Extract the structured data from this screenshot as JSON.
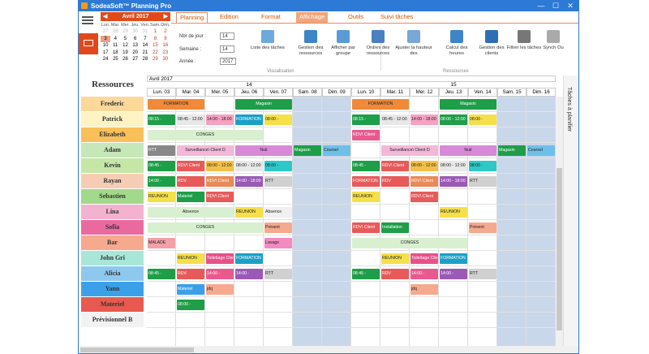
{
  "window": {
    "title": "SodeaSoft™ Planning Pro",
    "minimize": "—",
    "maximize": "☐",
    "close": "✕"
  },
  "calendar": {
    "month": "Avril 2017",
    "prev": "◀",
    "next": "▶",
    "weekdays": [
      "Lun.",
      "Mar.",
      "Mer.",
      "Jeu.",
      "Ven.",
      "Sam.",
      "Dim."
    ],
    "days": [
      [
        "27",
        "28",
        "29",
        "30",
        "31",
        "1",
        "2"
      ],
      [
        "3",
        "4",
        "5",
        "6",
        "7",
        "8",
        "9"
      ],
      [
        "10",
        "11",
        "12",
        "13",
        "14",
        "15",
        "16"
      ],
      [
        "17",
        "18",
        "19",
        "20",
        "21",
        "22",
        "23"
      ],
      [
        "24",
        "25",
        "26",
        "27",
        "28",
        "29",
        "30"
      ]
    ]
  },
  "tabs": [
    "Planning",
    "Edition",
    "Format",
    "Affichage",
    "Outils",
    "Suivi tâches"
  ],
  "visualisation": {
    "nbr_jour_label": "Nbr de jour :",
    "nbr_jour": "14",
    "semaine_label": "Semaine :",
    "semaine": "14",
    "annee_label": "Année :",
    "annee": "2017",
    "group_label": "Visualisation"
  },
  "ribbon_buttons": [
    {
      "label": "Liste des tâches",
      "color": "#6fa8dc"
    },
    {
      "label": "Gestion des ressources",
      "color": "#3d85c6"
    },
    {
      "label": "Afficher par groupe",
      "color": "#5b9bd5"
    },
    {
      "label": "Ordres des ressources",
      "color": "#4a7fc1"
    },
    {
      "label": "Ajuster la hauteur des",
      "color": "#7aa6d8"
    },
    {
      "label": "Calcul des heures",
      "color": "#3d85c6"
    },
    {
      "label": "Gestion des clients",
      "color": "#2e6fb4"
    },
    {
      "label": "Filtrer les tâches",
      "color": "#777777"
    },
    {
      "label": "Synch Ou",
      "color": "#aaaaaa"
    }
  ],
  "ressources_group_label": "Ressources",
  "planning": {
    "month_label": "Avril 2017",
    "week1": "14",
    "week2": "15",
    "days": [
      "Lun. 03",
      "Mar. 04",
      "Mer. 05",
      "Jeu. 06",
      "Ven. 07",
      "Sam. 08",
      "Dim. 09",
      "Lun. 10",
      "Mar. 11",
      "Mer. 12",
      "Jeu. 13",
      "Ven. 14",
      "Sam. 15",
      "Dim. 16"
    ],
    "resources_title": "Ressources",
    "resources": [
      {
        "name": "Frederic",
        "color": "#fcd89a"
      },
      {
        "name": "Patrick",
        "color": "#fff3c4"
      },
      {
        "name": "Elizabeth",
        "color": "#f9c05a"
      },
      {
        "name": "Adam",
        "color": "#c6e7b8"
      },
      {
        "name": "Kevin",
        "color": "#c5e6a6"
      },
      {
        "name": "Rayan",
        "color": "#f6cdb4"
      },
      {
        "name": "Sebastien",
        "color": "#a2d98a"
      },
      {
        "name": "Lina",
        "color": "#f3b2cf"
      },
      {
        "name": "Sofia",
        "color": "#ea6aa0"
      },
      {
        "name": "Bar",
        "color": "#f5a98e"
      },
      {
        "name": "John Gri",
        "color": "#a8e6d8"
      },
      {
        "name": "Alicia",
        "color": "#8fc8ef"
      },
      {
        "name": "Yann",
        "color": "#3ba0e8"
      },
      {
        "name": "Materiel",
        "color": "#e85a4f"
      },
      {
        "name": "Prévisionnel B",
        "color": "#f2f2f2"
      }
    ],
    "tasks_panel": "Tâches à planifier",
    "events": [
      {
        "row": 0,
        "col": 0,
        "span": 2,
        "text": "FORMATION",
        "color": "#f08a3a"
      },
      {
        "row": 0,
        "col": 3,
        "span": 2,
        "text": "Magasin",
        "color": "#1e9e48"
      },
      {
        "row": 0,
        "col": 7,
        "span": 2,
        "text": "FORMATION",
        "color": "#f08a3a"
      },
      {
        "row": 0,
        "col": 10,
        "span": 2,
        "text": "Magasin",
        "color": "#1e9e48"
      },
      {
        "row": 1,
        "col": 0,
        "span": 1,
        "text": "08:15 -",
        "color": "#1e9e48"
      },
      {
        "row": 1,
        "col": 1,
        "span": 1,
        "text": "08:45 - 12:00",
        "color": "#e8e8e8"
      },
      {
        "row": 1,
        "col": 2,
        "span": 1,
        "text": "14:00 - 18:00",
        "color": "#f6a2c2"
      },
      {
        "row": 1,
        "col": 3,
        "span": 1,
        "text": "FORMATION",
        "color": "#1aa0c8"
      },
      {
        "row": 1,
        "col": 4,
        "span": 1,
        "text": "08:00 -",
        "color": "#f5e04a"
      },
      {
        "row": 1,
        "col": 7,
        "span": 1,
        "text": "08:15 -",
        "color": "#1e9e48"
      },
      {
        "row": 1,
        "col": 8,
        "span": 1,
        "text": "08:45 - 12:00",
        "color": "#e8e8e8"
      },
      {
        "row": 1,
        "col": 9,
        "span": 1,
        "text": "14:00 - 18:00",
        "color": "#f6a2c2"
      },
      {
        "row": 1,
        "col": 10,
        "span": 1,
        "text": "08:00 - 12:00",
        "color": "#1e9e48"
      },
      {
        "row": 1,
        "col": 11,
        "span": 1,
        "text": "08:00 -",
        "color": "#f5e04a"
      },
      {
        "row": 2,
        "col": 0,
        "span": 4,
        "text": "CONGES",
        "color": "#d8f0d0"
      },
      {
        "row": 2,
        "col": 7,
        "span": 1,
        "text": "RDV\\ Client",
        "color": "#e85a8e"
      },
      {
        "row": 3,
        "col": 0,
        "span": 1,
        "text": "RTT",
        "color": "#888888"
      },
      {
        "row": 3,
        "col": 1,
        "span": 2,
        "text": "Surveillance\\ Client D",
        "color": "#f3b8d8"
      },
      {
        "row": 3,
        "col": 3,
        "span": 2,
        "text": "Nuit",
        "color": "#d88ad8"
      },
      {
        "row": 3,
        "col": 5,
        "span": 1,
        "text": "Magasin",
        "color": "#1e9e48"
      },
      {
        "row": 3,
        "col": 6,
        "span": 1,
        "text": "Coursel",
        "color": "#6fc0e8"
      },
      {
        "row": 3,
        "col": 8,
        "span": 2,
        "text": "Surveillance\\ Client D",
        "color": "#f3b8d8"
      },
      {
        "row": 3,
        "col": 10,
        "span": 2,
        "text": "Nuit",
        "color": "#d88ad8"
      },
      {
        "row": 3,
        "col": 12,
        "span": 1,
        "text": "Magasin",
        "color": "#1e9e48"
      },
      {
        "row": 3,
        "col": 13,
        "span": 1,
        "text": "Coursel",
        "color": "#6fc0e8"
      },
      {
        "row": 4,
        "col": 0,
        "span": 1,
        "text": "08:45 -",
        "color": "#1e9e48"
      },
      {
        "row": 4,
        "col": 1,
        "span": 1,
        "text": "RDV\\ Client",
        "color": "#e85a5a"
      },
      {
        "row": 4,
        "col": 2,
        "span": 1,
        "text": "08:00 - 12:00",
        "color": "#f5c04a"
      },
      {
        "row": 4,
        "col": 3,
        "span": 1,
        "text": "08:00 - 12:00",
        "color": "#e8e8e8"
      },
      {
        "row": 4,
        "col": 4,
        "span": 1,
        "text": "08:00 -",
        "color": "#2ec8c8"
      },
      {
        "row": 4,
        "col": 7,
        "span": 1,
        "text": "08:45 -",
        "color": "#1e9e48"
      },
      {
        "row": 4,
        "col": 8,
        "span": 1,
        "text": "RDV\\ Client",
        "color": "#e85a5a"
      },
      {
        "row": 4,
        "col": 9,
        "span": 1,
        "text": "08:00 - 12:00",
        "color": "#f5c04a"
      },
      {
        "row": 4,
        "col": 10,
        "span": 1,
        "text": "08:00 - 12:00",
        "color": "#e8e8e8"
      },
      {
        "row": 4,
        "col": 11,
        "span": 1,
        "text": "08:00 -",
        "color": "#2ec8c8"
      },
      {
        "row": 5,
        "col": 0,
        "span": 1,
        "text": "14:00 -",
        "color": "#1e9e48"
      },
      {
        "row": 5,
        "col": 1,
        "span": 1,
        "text": "RDV",
        "color": "#e85a5a"
      },
      {
        "row": 5,
        "col": 2,
        "span": 1,
        "text": "RDV\\ Client",
        "color": "#e88a5a"
      },
      {
        "row": 5,
        "col": 3,
        "span": 1,
        "text": "14:00 - 18:00",
        "color": "#9b59b6"
      },
      {
        "row": 5,
        "col": 4,
        "span": 1,
        "text": "RTT",
        "color": "#d0d0d0"
      },
      {
        "row": 5,
        "col": 7,
        "span": 1,
        "text": "FORMATION",
        "color": "#e85a5a"
      },
      {
        "row": 5,
        "col": 8,
        "span": 1,
        "text": "RDV",
        "color": "#e85a5a"
      },
      {
        "row": 5,
        "col": 9,
        "span": 1,
        "text": "RDV\\ Client",
        "color": "#e88a5a"
      },
      {
        "row": 5,
        "col": 10,
        "span": 1,
        "text": "14:00 - 18:00",
        "color": "#9b59b6"
      },
      {
        "row": 5,
        "col": 11,
        "span": 1,
        "text": "RTT",
        "color": "#d0d0d0"
      },
      {
        "row": 6,
        "col": 0,
        "span": 1,
        "text": "REUNION",
        "color": "#f5e04a"
      },
      {
        "row": 6,
        "col": 1,
        "span": 1,
        "text": "Materiel",
        "color": "#1e9e48"
      },
      {
        "row": 6,
        "col": 2,
        "span": 1,
        "text": "RDV\\ Client",
        "color": "#e85a5a"
      },
      {
        "row": 6,
        "col": 7,
        "span": 1,
        "text": "REUNION",
        "color": "#f5e04a"
      },
      {
        "row": 6,
        "col": 9,
        "span": 1,
        "text": "RDV\\ Client",
        "color": "#e85a5a"
      },
      {
        "row": 7,
        "col": 0,
        "span": 3,
        "text": "Absence",
        "color": "#d8f0d0"
      },
      {
        "row": 7,
        "col": 3,
        "span": 1,
        "text": "REUNION",
        "color": "#f5e04a"
      },
      {
        "row": 7,
        "col": 4,
        "span": 1,
        "text": "Absence",
        "color": "#f0f0f0"
      },
      {
        "row": 7,
        "col": 10,
        "span": 1,
        "text": "REUNION",
        "color": "#f5e04a"
      },
      {
        "row": 8,
        "col": 0,
        "span": 4,
        "text": "CONGES",
        "color": "#d8f0d0"
      },
      {
        "row": 8,
        "col": 4,
        "span": 1,
        "text": "Présent",
        "color": "#f5a98e"
      },
      {
        "row": 8,
        "col": 7,
        "span": 1,
        "text": "RDV\\ Client",
        "color": "#e85a5a"
      },
      {
        "row": 8,
        "col": 8,
        "span": 1,
        "text": "Installation",
        "color": "#1e9e48"
      },
      {
        "row": 8,
        "col": 11,
        "span": 1,
        "text": "Présent",
        "color": "#f5a98e"
      },
      {
        "row": 9,
        "col": 0,
        "span": 1,
        "text": "MALADE",
        "color": "#f3a0a8"
      },
      {
        "row": 9,
        "col": 4,
        "span": 1,
        "text": "Lavage",
        "color": "#f38ac0"
      },
      {
        "row": 9,
        "col": 7,
        "span": 4,
        "text": "CONGES",
        "color": "#d8f0d0"
      },
      {
        "row": 10,
        "col": 1,
        "span": 1,
        "text": "REUNION",
        "color": "#f5e04a"
      },
      {
        "row": 10,
        "col": 2,
        "span": 1,
        "text": "Toilettage Client A",
        "color": "#e8508a"
      },
      {
        "row": 10,
        "col": 3,
        "span": 1,
        "text": "FORMATION",
        "color": "#1aa0c8"
      },
      {
        "row": 10,
        "col": 8,
        "span": 1,
        "text": "REUNION",
        "color": "#f5e04a"
      },
      {
        "row": 10,
        "col": 9,
        "span": 1,
        "text": "Toilettage Client A",
        "color": "#e8508a"
      },
      {
        "row": 10,
        "col": 10,
        "span": 1,
        "text": "FORMATION",
        "color": "#1aa0c8"
      },
      {
        "row": 11,
        "col": 0,
        "span": 1,
        "text": "08:45 -",
        "color": "#1e9e48"
      },
      {
        "row": 11,
        "col": 1,
        "span": 1,
        "text": "RDV",
        "color": "#e85a5a"
      },
      {
        "row": 11,
        "col": 2,
        "span": 1,
        "text": "14:00 -",
        "color": "#e85a8e"
      },
      {
        "row": 11,
        "col": 3,
        "span": 1,
        "text": "14:00 -",
        "color": "#9b59b6"
      },
      {
        "row": 11,
        "col": 4,
        "span": 1,
        "text": "RTT",
        "color": "#d0d0d0"
      },
      {
        "row": 11,
        "col": 7,
        "span": 1,
        "text": "08:45 -",
        "color": "#1e9e48"
      },
      {
        "row": 11,
        "col": 8,
        "span": 1,
        "text": "RDV",
        "color": "#e85a5a"
      },
      {
        "row": 11,
        "col": 9,
        "span": 1,
        "text": "14:00 -",
        "color": "#e85a8e"
      },
      {
        "row": 11,
        "col": 10,
        "span": 1,
        "text": "14:00 -",
        "color": "#9b59b6"
      },
      {
        "row": 11,
        "col": 11,
        "span": 1,
        "text": "RTT",
        "color": "#d0d0d0"
      },
      {
        "row": 12,
        "col": 1,
        "span": 1,
        "text": "Materiel",
        "color": "#3ba0e8"
      },
      {
        "row": 12,
        "col": 2,
        "span": 1,
        "text": "jdq",
        "color": "#f5a98e"
      },
      {
        "row": 12,
        "col": 9,
        "span": 1,
        "text": "jdq",
        "color": "#f5a98e"
      },
      {
        "row": 13,
        "col": 1,
        "span": 1,
        "text": "08:00 -",
        "color": "#1e9e48"
      }
    ]
  }
}
